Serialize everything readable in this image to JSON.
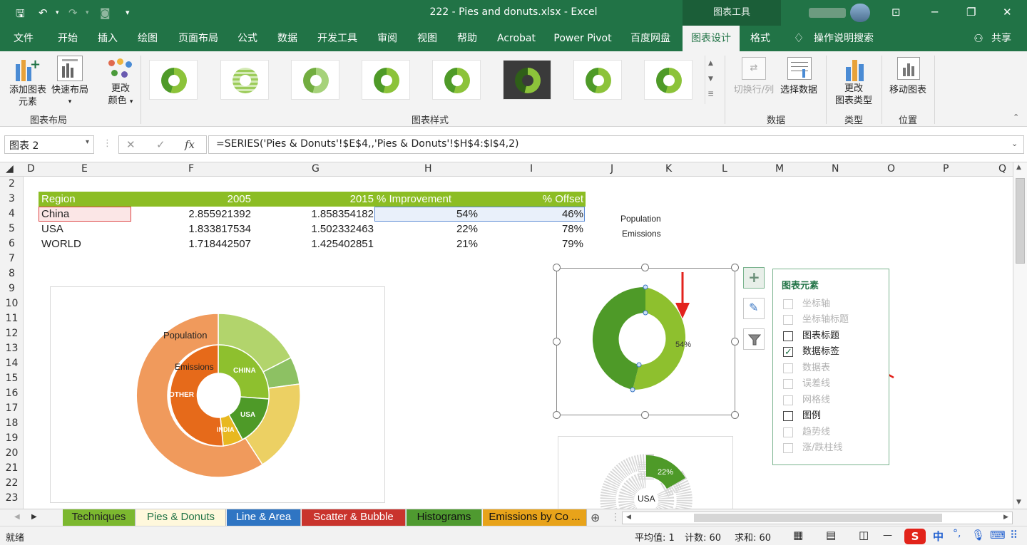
{
  "titlebar": {
    "doc_title": "222 - Pies and donuts.xlsx  -  Excel",
    "chart_tools": "图表工具",
    "save_icon": "save-icon",
    "undo_icon": "undo-icon",
    "redo_icon": "redo-icon"
  },
  "tabs": [
    "文件",
    "开始",
    "插入",
    "绘图",
    "页面布局",
    "公式",
    "数据",
    "开发工具",
    "审阅",
    "视图",
    "帮助",
    "Acrobat",
    "Power Pivot",
    "百度网盘",
    "图表设计",
    "格式"
  ],
  "active_tab": "图表设计",
  "tell_me": "操作说明搜索",
  "share": "共享",
  "ribbon": {
    "add_element": [
      "添加图表",
      "元素"
    ],
    "quick_layout": [
      "快速布局"
    ],
    "change_colors": [
      "更改",
      "颜色"
    ],
    "group_layout": "图表布局",
    "group_styles": "图表样式",
    "switch_row_col": "切换行/列",
    "select_data": "选择数据",
    "group_data": "数据",
    "change_type": [
      "更改",
      "图表类型"
    ],
    "group_type": "类型",
    "move_chart": "移动图表",
    "group_location": "位置"
  },
  "formula_bar": {
    "name_box": "图表 2",
    "fx": "fx",
    "formula": "=SERIES('Pies & Donuts'!$E$4,,'Pies & Donuts'!$H$4:$I$4,2)"
  },
  "columns": [
    "D",
    "E",
    "F",
    "G",
    "H",
    "I",
    "J",
    "K",
    "L",
    "M",
    "N",
    "O",
    "P",
    "Q"
  ],
  "rows": [
    "2",
    "3",
    "4",
    "5",
    "6",
    "7",
    "8",
    "9",
    "10",
    "11",
    "12",
    "13",
    "14",
    "15",
    "16",
    "17",
    "18",
    "19",
    "20",
    "21",
    "22",
    "23"
  ],
  "table": {
    "headers": [
      "Region",
      "2005",
      "2015",
      "% Improvement",
      "% Offset"
    ],
    "rows": [
      [
        "China",
        "2.855921392",
        "1.858354182",
        "54%",
        "46%"
      ],
      [
        "USA",
        "1.833817534",
        "1.502332463",
        "22%",
        "78%"
      ],
      [
        "WORLD",
        "1.718442507",
        "1.425402851",
        "21%",
        "79%"
      ]
    ]
  },
  "chart_data": [
    {
      "type": "pie",
      "labels": [
        "Population",
        "Emissions",
        "CHINA",
        "USA",
        "INDIA",
        "OTHER"
      ]
    },
    {
      "type": "pie",
      "title": [
        "Population",
        "Emissions"
      ],
      "categories": [
        "% Improvement",
        "% Offset"
      ],
      "values": [
        54,
        46
      ],
      "data_label": "54%"
    },
    {
      "type": "pie",
      "categories": [
        "% Improvement",
        "% Offset"
      ],
      "values": [
        22,
        78
      ],
      "data_label": "22%",
      "center_label": "USA"
    }
  ],
  "chart_elements_panel": {
    "title": "图表元素",
    "options": [
      {
        "label": "坐标轴",
        "checked": false,
        "enabled": false
      },
      {
        "label": "坐标轴标题",
        "checked": false,
        "enabled": false
      },
      {
        "label": "图表标题",
        "checked": false,
        "enabled": true
      },
      {
        "label": "数据标签",
        "checked": true,
        "enabled": true
      },
      {
        "label": "数据表",
        "checked": false,
        "enabled": false
      },
      {
        "label": "误差线",
        "checked": false,
        "enabled": false
      },
      {
        "label": "网格线",
        "checked": false,
        "enabled": false
      },
      {
        "label": "图例",
        "checked": false,
        "enabled": true
      },
      {
        "label": "趋势线",
        "checked": false,
        "enabled": false
      },
      {
        "label": "涨/跌柱线",
        "checked": false,
        "enabled": false
      }
    ]
  },
  "sheet_tabs": [
    {
      "label": "Techniques",
      "color": "#7cb82f"
    },
    {
      "label": "Pies & Donuts",
      "color": "#fff8dc"
    },
    {
      "label": "Line & Area",
      "color": "#2f75c3"
    },
    {
      "label": "Scatter & Bubble",
      "color": "#c9342d"
    },
    {
      "label": "Histograms",
      "color": "#4f9a30"
    },
    {
      "label": "Emissions by Co ...",
      "color": "#e8a31a"
    }
  ],
  "status": {
    "ready": "就绪",
    "average": "平均值: 1",
    "count": "计数: 60",
    "sum": "求和: 60",
    "ime": "中"
  }
}
